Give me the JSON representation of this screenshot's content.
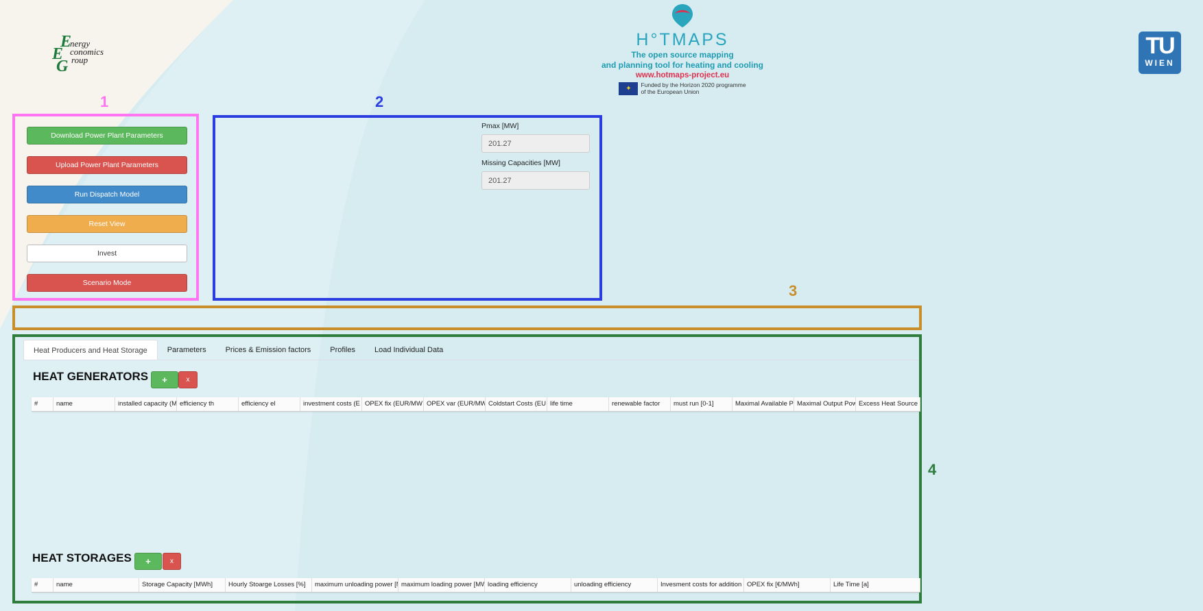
{
  "logos": {
    "eeg": {
      "line1": "nergy",
      "line2": "conomics",
      "line3": "roup"
    },
    "hotmaps": {
      "title": "H°TMAPS",
      "tagline1": "The open source mapping",
      "tagline2": "and planning tool for heating and cooling",
      "url": "www.hotmaps-project.eu",
      "funding1": "Funded by the Horizon 2020 programme",
      "funding2": "of the European Union"
    },
    "tu": {
      "top": "TU",
      "bottom": "WIEN"
    }
  },
  "annotations": {
    "n1": "1",
    "n2": "2",
    "n3": "3",
    "n4": "4"
  },
  "colors": {
    "box1": "#ff74f0",
    "box2": "#2b3de0",
    "box3": "#c98e2c",
    "box4": "#2e7d3d",
    "green": "#5cb85c",
    "red": "#d9534f",
    "blue": "#428bca",
    "orange": "#f0ad4e"
  },
  "actions": {
    "download": "Download Power Plant Parameters",
    "upload": "Upload Power Plant Parameters",
    "run": "Run Dispatch Model",
    "reset": "Reset View",
    "invest": "Invest",
    "scenario": "Scenario Mode"
  },
  "results": {
    "pmax_label": "Pmax [MW]",
    "pmax_value": "201.27",
    "missing_label": "Missing Capacities [MW]",
    "missing_value": "201.27"
  },
  "tabs": [
    "Heat Producers and Heat Storage",
    "Parameters",
    "Prices & Emission factors",
    "Profiles",
    "Load Individual Data"
  ],
  "generators": {
    "title": "HEAT GENERATORS",
    "add": "+",
    "remove": "x",
    "columns": [
      "#",
      "name",
      "installed capacity (M",
      "efficiency th",
      "efficiency el",
      "investment costs (E",
      "OPEX fix (EUR/MW",
      "OPEX var (EUR/MW",
      "Coldstart Costs (EU",
      "life time",
      "renewable factor",
      "must run [0-1]",
      "Maximal Available P",
      "Maximal Output Pow",
      "Excess Heat Source"
    ]
  },
  "storages": {
    "title": "HEAT STORAGES",
    "add": "+",
    "remove": "x",
    "columns": [
      "#",
      "name",
      "Storage Capacity [MWh]",
      "Hourly Stoarge Losses [%]",
      "maximum unloading power [M",
      "maximum loading power [MW",
      "loading efficiency",
      "unloading efficiency",
      "Invesment costs for addition",
      "OPEX fix [€/MWh]",
      "Life Time [a]"
    ]
  }
}
